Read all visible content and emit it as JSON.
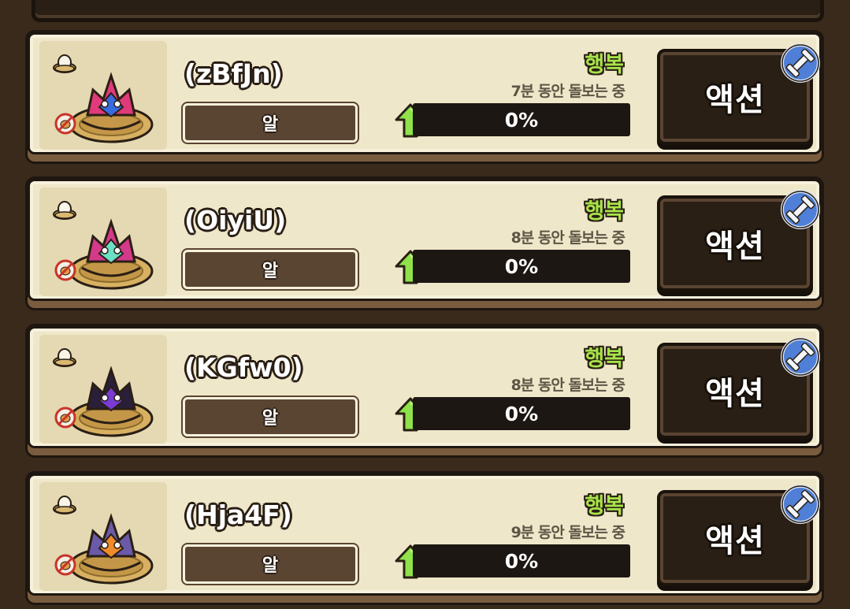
{
  "pets": [
    {
      "name": "(zBfJn)",
      "type": "알",
      "mood": "행복",
      "care_time": "7분 동안 돌보는 중",
      "progress": "0%",
      "progress_value": 0,
      "action": "액션",
      "monster_color": "#e03a7a",
      "monster_accent": "#3a6adf"
    },
    {
      "name": "(OiyiU)",
      "type": "알",
      "mood": "행복",
      "care_time": "8분 동안 돌보는 중",
      "progress": "0%",
      "progress_value": 0,
      "action": "액션",
      "monster_color": "#d43a8a",
      "monster_accent": "#6be0c4"
    },
    {
      "name": "(KGfw0)",
      "type": "알",
      "mood": "행복",
      "care_time": "8분 동안 돌보는 중",
      "progress": "0%",
      "progress_value": 0,
      "action": "액션",
      "monster_color": "#2a1f3a",
      "monster_accent": "#7a3ad4"
    },
    {
      "name": "(Hja4F)",
      "type": "알",
      "mood": "행복",
      "care_time": "9분 동안 돌보는 중",
      "progress": "0%",
      "progress_value": 0,
      "action": "액션",
      "monster_color": "#6a5aa8",
      "monster_accent": "#f08a2a"
    }
  ],
  "colors": {
    "mood": "#a8e44a",
    "arrow": "#8fe24a",
    "card_bg": "#efe7c9",
    "button_bg": "#2a1f15"
  }
}
